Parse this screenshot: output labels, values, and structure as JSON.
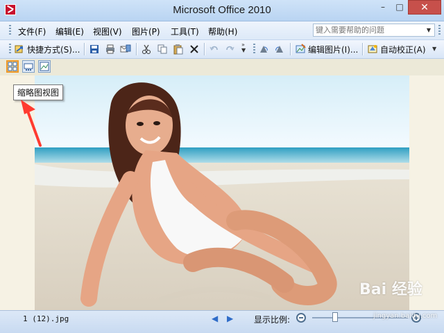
{
  "window": {
    "title": "Microsoft Office 2010",
    "min_label": "–",
    "max_label": "□",
    "close_label": "✕"
  },
  "menu": {
    "items": [
      {
        "label": "文件(F)"
      },
      {
        "label": "编辑(E)"
      },
      {
        "label": "视图(V)"
      },
      {
        "label": "图片(P)"
      },
      {
        "label": "工具(T)"
      },
      {
        "label": "帮助(H)"
      }
    ],
    "help_placeholder": "键入需要帮助的问题"
  },
  "toolbar": {
    "shortcut_label": "快捷方式(S)...",
    "edit_picture_label": "编辑图片(I)...",
    "auto_correct_label": "自动校正(A)"
  },
  "view": {
    "tooltip": "缩略图视图"
  },
  "status": {
    "file_name": "1 (12).jpg",
    "zoom_label": "显示比例:",
    "zoom_level": 0.22
  },
  "watermark": {
    "brand": "Bai 经验",
    "url": "jingyan.baidu.com"
  },
  "colors": {
    "accent": "#f09a28",
    "toolbar_bg": "#dde9f8",
    "close_button": "#c7504b",
    "arrow": "#ff3b30"
  }
}
